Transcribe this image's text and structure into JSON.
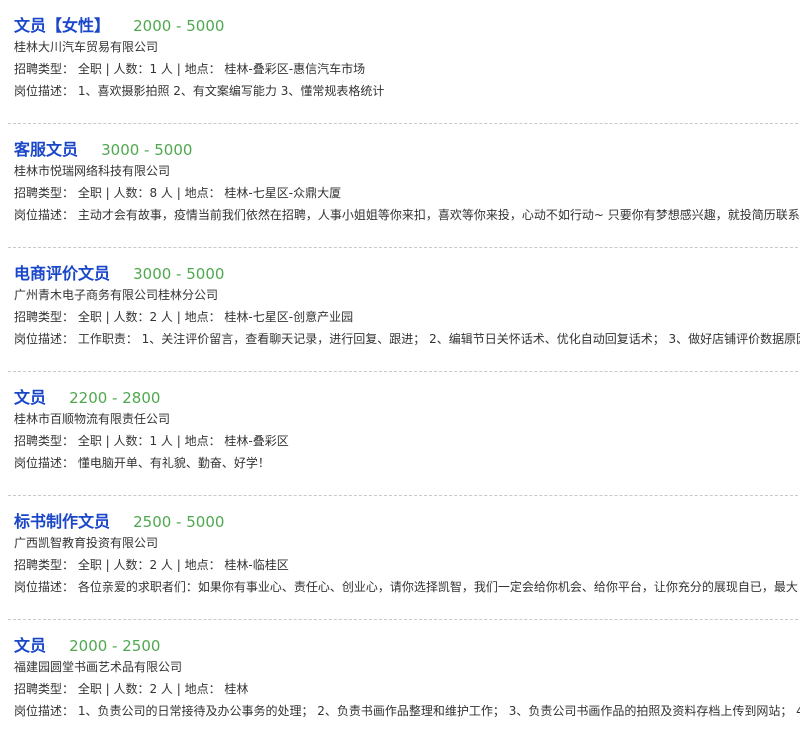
{
  "jobs": [
    {
      "title": "文员【女性】",
      "salary": "2000 - 5000",
      "company": "桂林大川汽车贸易有限公司",
      "meta": "招聘类型：  全职 | 人数：1 人 | 地点：  桂林-叠彩区-惠信汽车市场",
      "desc": "岗位描述：  1、喜欢摄影拍照 2、有文案编写能力 3、懂常规表格统计"
    },
    {
      "title": "客服文员",
      "salary": "3000 - 5000",
      "company": "桂林市悦瑞网络科技有限公司",
      "meta": "招聘类型：  全职 | 人数：8 人 | 地点：  桂林-七星区-众鼎大厦",
      "desc": "岗位描述：  主动才会有故事，疫情当前我们依然在招聘，人事小姐姐等你来扣，喜欢等你来投，心动不如行动~ 只要你有梦想感兴趣，就投简历联系"
    },
    {
      "title": "电商评价文员",
      "salary": "3000 - 5000",
      "company": "广州青木电子商务有限公司桂林分公司",
      "meta": "招聘类型：  全职 | 人数：2 人 | 地点：  桂林-七星区-创意产业园",
      "desc": "岗位描述：  工作职责：  1、关注评价留言，查看聊天记录，进行回复、跟进；  2、编辑节日关怀话术、优化自动回复话术；  3、做好店铺评价数据原因"
    },
    {
      "title": "文员",
      "salary": "2200 - 2800",
      "company": "桂林市百顺物流有限责任公司",
      "meta": "招聘类型：  全职 | 人数：1 人 | 地点：  桂林-叠彩区",
      "desc": "岗位描述：  懂电脑开单、有礼貌、勤奋、好学！"
    },
    {
      "title": "标书制作文员",
      "salary": "2500 - 5000",
      "company": "广西凯智教育投资有限公司",
      "meta": "招聘类型：  全职 | 人数：2 人 | 地点：  桂林-临桂区",
      "desc": "岗位描述：  各位亲爱的求职者们：如果你有事业心、责任心、创业心，请你选择凯智，我们一定会给你机会、给你平台，让你充分的展现自已，最大"
    },
    {
      "title": "文员",
      "salary": "2000 - 2500",
      "company": "福建园圆堂书画艺术品有限公司",
      "meta": "招聘类型：  全职 | 人数：2 人 | 地点：  桂林",
      "desc": "岗位描述：  1、负责公司的日常接待及办公事务的处理；  2、负责书画作品整理和维护工作；  3、负责公司书画作品的拍照及资料存档上传到网站；  4"
    }
  ]
}
